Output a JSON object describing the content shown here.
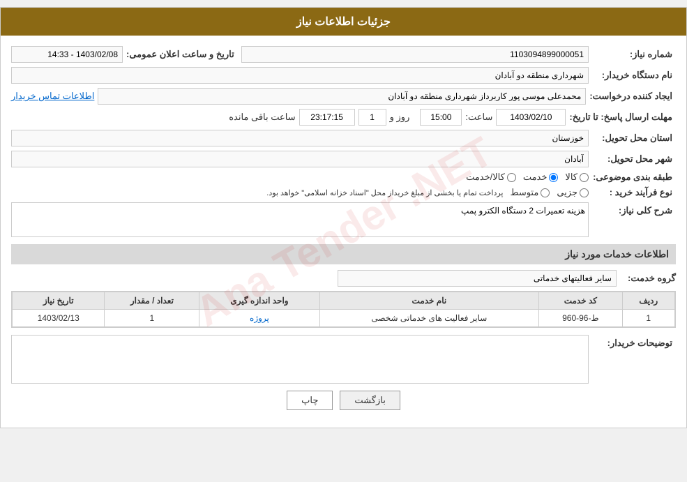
{
  "page": {
    "title": "جزئیات اطلاعات نیاز",
    "watermark": "Ana Tender .NET"
  },
  "form": {
    "shomara_niaz_label": "شماره نیاز:",
    "shomara_niaz_value": "1103094899000051",
    "tarikh_label": "تاریخ و ساعت اعلان عمومی:",
    "tarikh_value": "1403/02/08 - 14:33",
    "nam_dastgah_label": "نام دستگاه خریدار:",
    "nam_dastgah_value": "شهرداری منطقه دو آبادان",
    "ijad_konande_label": "ایجاد کننده درخواست:",
    "ijad_konande_value": "محمدعلی موسی پور کاربرداز شهرداری منطقه دو آبادان",
    "ijad_konande_link": "اطلاعات تماس خریدار",
    "mohlat_label": "مهلت ارسال پاسخ: تا تاریخ:",
    "mohlat_date": "1403/02/10",
    "mohlat_saat_label": "ساعت:",
    "mohlat_saat_value": "15:00",
    "mohlat_roz_label": "روز و",
    "mohlat_roz_value": "1",
    "mohlat_saat_mande_label": "ساعت باقی مانده",
    "mohlat_saat_mande_value": "23:17:15",
    "ostan_label": "استان محل تحویل:",
    "ostan_value": "خوزستان",
    "shahr_label": "شهر محل تحویل:",
    "shahr_value": "آبادان",
    "tabagheh_label": "طبقه بندی موضوعی:",
    "radio_kala": "کالا",
    "radio_khedmat": "خدمت",
    "radio_kala_khedmat": "کالا/خدمت",
    "radio_kala_selected": false,
    "radio_khedmat_selected": true,
    "radio_kala_khedmat_selected": false,
    "nooe_farayand_label": "نوع فرآیند خرید :",
    "radio_jozvi": "جزیی",
    "radio_motovaset": "متوسط",
    "nooe_farayand_text": "پرداخت تمام یا بخشی از مبلغ خریداز محل \"اسناد خزانه اسلامی\" خواهد بود.",
    "sharh_label": "شرح کلی نیاز:",
    "sharh_value": "هزینه تعمیرات 2 دستگاه الکترو پمپ",
    "info_khadamat_title": "اطلاعات خدمات مورد نیاز",
    "grooh_label": "گروه خدمت:",
    "grooh_value": "سایر فعالیتهای خدماتی",
    "table": {
      "headers": [
        "ردیف",
        "کد خدمت",
        "نام خدمت",
        "واحد اندازه گیری",
        "تعداد / مقدار",
        "تاریخ نیاز"
      ],
      "rows": [
        {
          "radif": "1",
          "kod": "ط-96-960",
          "naam": "سایر فعالیت های خدماتی شخصی",
          "vahed": "پروژه",
          "tedad": "1",
          "tarikh": "1403/02/13"
        }
      ]
    },
    "tawzihat_label": "توضیحات خریدار:",
    "tawzihat_value": ""
  },
  "buttons": {
    "print_label": "چاپ",
    "back_label": "بازگشت"
  }
}
